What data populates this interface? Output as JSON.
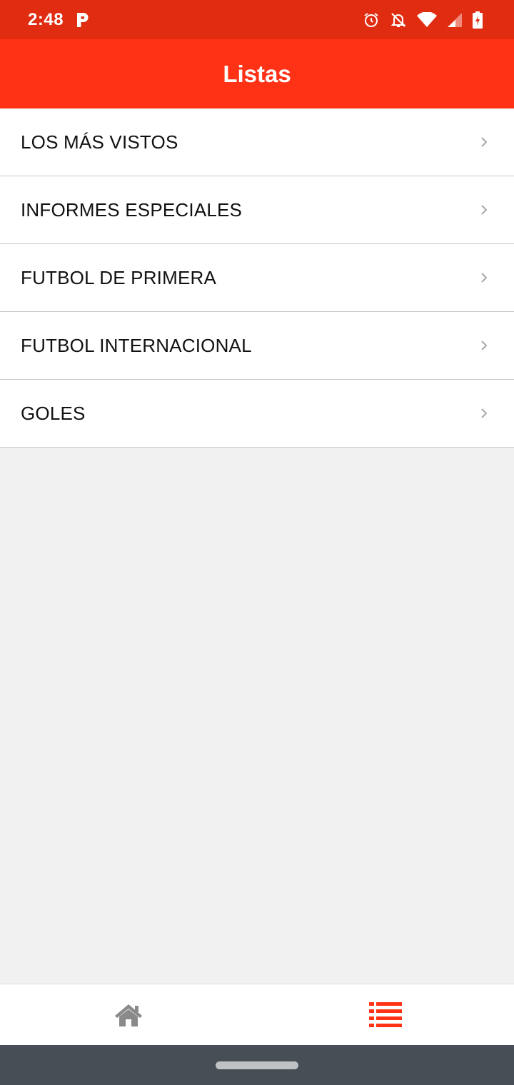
{
  "status_bar": {
    "time": "2:48",
    "icons": [
      "parking-p-icon",
      "alarm-icon",
      "notifications-off-icon",
      "wifi-icon",
      "cell-signal-icon",
      "battery-charging-icon"
    ]
  },
  "app_bar": {
    "title": "Listas"
  },
  "list": {
    "items": [
      {
        "label": "LOS MÁS VISTOS"
      },
      {
        "label": "INFORMES ESPECIALES"
      },
      {
        "label": "FUTBOL DE PRIMERA"
      },
      {
        "label": "FUTBOL INTERNACIONAL"
      },
      {
        "label": "GOLES"
      }
    ]
  },
  "bottom_nav": {
    "items": [
      {
        "icon": "home-icon",
        "active": false
      },
      {
        "icon": "list-icon",
        "active": true
      }
    ]
  },
  "colors": {
    "status_bar": "#e02d12",
    "app_bar": "#ff3215",
    "active_nav": "#ff3215",
    "inactive_nav": "#8a8a8a",
    "background": "#f1f1f1",
    "system_nav": "#474e55"
  }
}
